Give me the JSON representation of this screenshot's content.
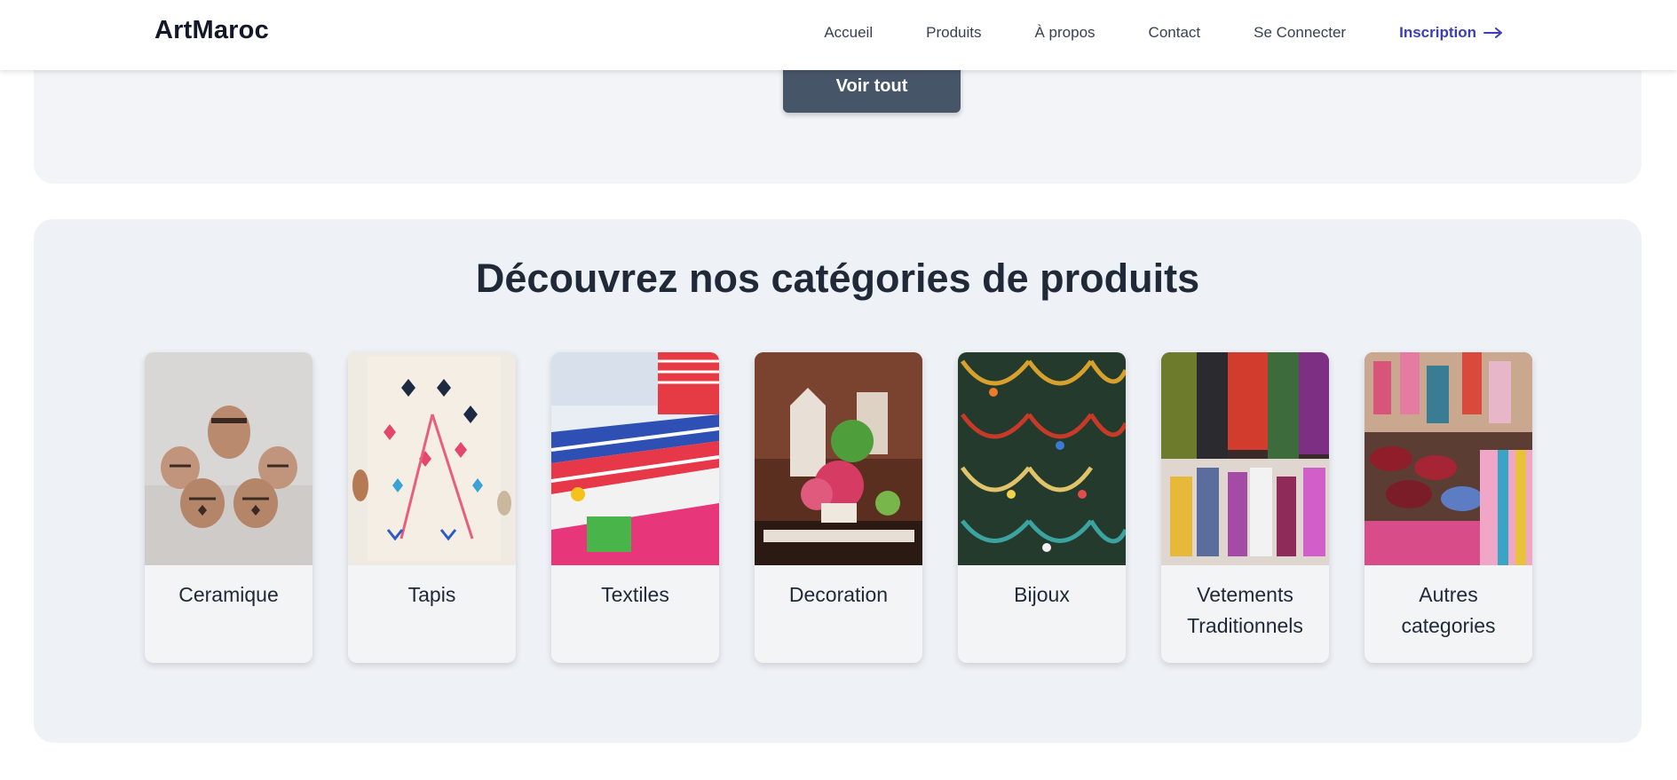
{
  "header": {
    "brand": "ArtMaroc",
    "nav": [
      {
        "label": "Accueil"
      },
      {
        "label": "Produits"
      },
      {
        "label": "À propos"
      },
      {
        "label": "Contact"
      },
      {
        "label": "Se Connecter"
      }
    ],
    "cta": {
      "label": "Inscription",
      "icon": "arrow-right-icon",
      "color": "#3b3fb6"
    }
  },
  "products_section": {
    "view_all_label": "Voir tout",
    "button_color": "#475569"
  },
  "categories_section": {
    "title": "Découvrez nos catégories de produits",
    "categories": [
      {
        "label": "Ceramique"
      },
      {
        "label": "Tapis"
      },
      {
        "label": "Textiles"
      },
      {
        "label": "Decoration"
      },
      {
        "label": "Bijoux"
      },
      {
        "label": "Vetements Traditionnels"
      },
      {
        "label": "Autres categories"
      }
    ]
  }
}
